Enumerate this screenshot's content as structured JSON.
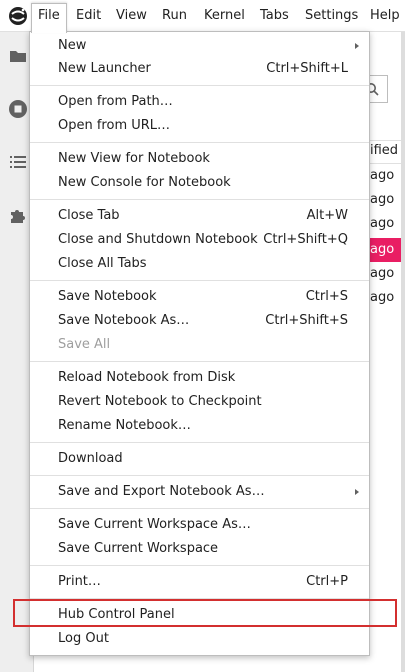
{
  "menubar": {
    "items": [
      {
        "label": "File"
      },
      {
        "label": "Edit"
      },
      {
        "label": "View"
      },
      {
        "label": "Run"
      },
      {
        "label": "Kernel"
      },
      {
        "label": "Tabs"
      },
      {
        "label": "Settings"
      },
      {
        "label": "Help"
      }
    ]
  },
  "background": {
    "column_header": "ified",
    "rows": [
      "ago",
      "ago",
      "ago",
      "ago",
      "ago",
      "ago"
    ],
    "selected_row_index": 3,
    "accent_color": "#e91e63"
  },
  "file_menu": {
    "items": [
      {
        "label": "New",
        "shortcut": "",
        "submenu": true
      },
      {
        "label": "New Launcher",
        "shortcut": "Ctrl+Shift+L"
      },
      {
        "label": "Open from Path…",
        "shortcut": ""
      },
      {
        "label": "Open from URL…",
        "shortcut": ""
      },
      {
        "label": "New View for Notebook",
        "shortcut": ""
      },
      {
        "label": "New Console for Notebook",
        "shortcut": ""
      },
      {
        "label": "Close Tab",
        "shortcut": "Alt+W"
      },
      {
        "label": "Close and Shutdown Notebook",
        "shortcut": "Ctrl+Shift+Q"
      },
      {
        "label": "Close All Tabs",
        "shortcut": ""
      },
      {
        "label": "Save Notebook",
        "shortcut": "Ctrl+S"
      },
      {
        "label": "Save Notebook As…",
        "shortcut": "Ctrl+Shift+S"
      },
      {
        "label": "Save All",
        "shortcut": "",
        "disabled": true
      },
      {
        "label": "Reload Notebook from Disk",
        "shortcut": ""
      },
      {
        "label": "Revert Notebook to Checkpoint",
        "shortcut": ""
      },
      {
        "label": "Rename Notebook…",
        "shortcut": ""
      },
      {
        "label": "Download",
        "shortcut": ""
      },
      {
        "label": "Save and Export Notebook As…",
        "shortcut": "",
        "submenu": true
      },
      {
        "label": "Save Current Workspace As…",
        "shortcut": ""
      },
      {
        "label": "Save Current Workspace",
        "shortcut": ""
      },
      {
        "label": "Print…",
        "shortcut": "Ctrl+P"
      },
      {
        "label": "Hub Control Panel",
        "shortcut": ""
      },
      {
        "label": "Log Out",
        "shortcut": ""
      }
    ]
  },
  "highlight": {
    "target": "Hub Control Panel",
    "color": "#d32f2f"
  }
}
